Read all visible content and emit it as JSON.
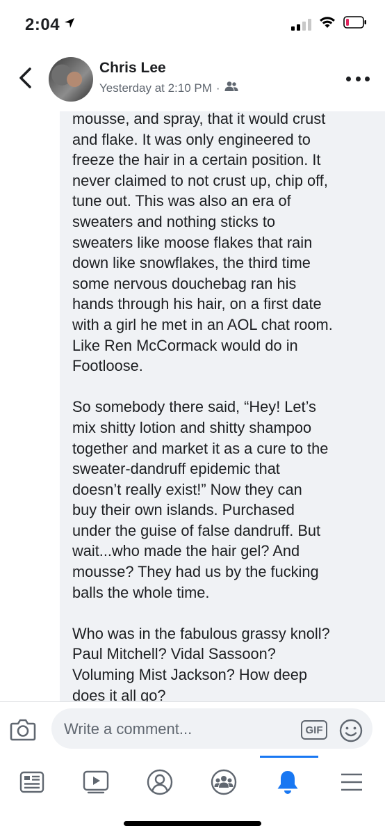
{
  "status_bar": {
    "time": "2:04"
  },
  "header": {
    "author_name": "Chris Lee",
    "timestamp": "Yesterday at 2:10 PM",
    "separator": "·"
  },
  "comment": {
    "paragraphs": [
      "mousse, and spray, that it would crust\nand flake.  It was only engineered to\nfreeze the hair in a certain position.  It\nnever claimed to not crust up, chip off,\ntune out.  This was also an era of\nsweaters and nothing sticks to\nsweaters like moose flakes that rain\ndown like snowflakes, the third time\nsome nervous douchebag ran his\nhands through his hair, on a first date\nwith a girl he met in an AOL chat room.\nLike Ren McCormack would do in\nFootloose.",
      "So somebody there said, “Hey!  Let’s\nmix shitty lotion and shitty shampoo\ntogether and market it as a cure to the\nsweater-dandruff epidemic that\ndoesn’t really exist!”  Now they can\nbuy their own islands.  Purchased\nunder the guise of false dandruff.  But\nwait...who made the hair gel?  And\nmousse?  They had us by the fucking\nballs the whole time.",
      "Who was in the fabulous grassy knoll?\nPaul Mitchell?  Vidal Sassoon?\nVoluming Mist Jackson?  How deep\ndoes it all go?"
    ]
  },
  "composer": {
    "placeholder": "Write a comment...",
    "gif_label": "GIF"
  },
  "tabs": [
    {
      "icon": "news-feed-icon",
      "active": false
    },
    {
      "icon": "watch-icon",
      "active": false
    },
    {
      "icon": "profile-icon",
      "active": false
    },
    {
      "icon": "groups-icon",
      "active": false
    },
    {
      "icon": "notifications-bell-icon",
      "active": true
    },
    {
      "icon": "menu-icon",
      "active": false
    }
  ],
  "colors": {
    "accent": "#1877f2",
    "comment_bg": "#f0f2f5",
    "text": "#1c1e21",
    "secondary_text": "#606770",
    "battery_low": "#e0245e"
  }
}
